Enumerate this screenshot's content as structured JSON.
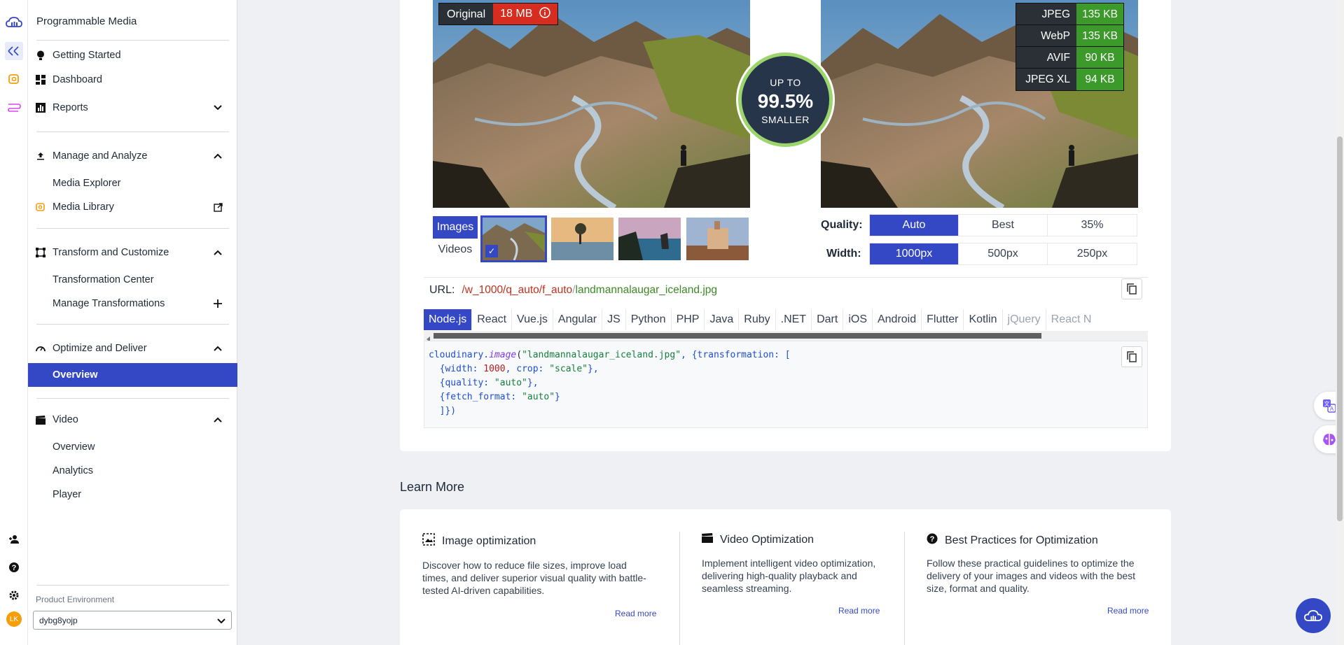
{
  "sidebar": {
    "title": "Programmable Media",
    "items": [
      {
        "label": "Getting Started"
      },
      {
        "label": "Dashboard"
      },
      {
        "label": "Reports"
      },
      {
        "label": "Manage and Analyze"
      },
      {
        "label": "Media Explorer"
      },
      {
        "label": "Media Library"
      },
      {
        "label": "Transform and Customize"
      },
      {
        "label": "Transformation Center"
      },
      {
        "label": "Manage Transformations"
      },
      {
        "label": "Optimize and Deliver"
      },
      {
        "label": "Overview"
      },
      {
        "label": "Video"
      },
      {
        "label": "Overview"
      },
      {
        "label": "Analytics"
      },
      {
        "label": "Player"
      }
    ],
    "env_label": "Product Environment",
    "env_value": "dybg8yojp",
    "avatar_initials": "LK"
  },
  "compare": {
    "original_label": "Original",
    "original_size": "18 MB",
    "formats": [
      {
        "name": "JPEG",
        "size": "135 KB"
      },
      {
        "name": "WebP",
        "size": "135 KB"
      },
      {
        "name": "AVIF",
        "size": "90 KB"
      },
      {
        "name": "JPEG XL",
        "size": "94 KB"
      }
    ],
    "circle_top": "UP TO",
    "circle_value": "99.5%",
    "circle_bottom": "SMALLER"
  },
  "media_toggle": {
    "images": "Images",
    "videos": "Videos"
  },
  "quality": {
    "label": "Quality:",
    "options": [
      "Auto",
      "Best",
      "35%"
    ],
    "selected": "Auto"
  },
  "width": {
    "label": "Width:",
    "options": [
      "1000px",
      "500px",
      "250px"
    ],
    "selected": "1000px"
  },
  "url": {
    "label": "URL:",
    "slash": "/",
    "transform": "w_1000/q_auto/f_auto",
    "slash2": "/",
    "file": "landmannalaugar_iceland.jpg"
  },
  "langs": [
    "Node.js",
    "React",
    "Vue.js",
    "Angular",
    "JS",
    "Python",
    "PHP",
    "Java",
    "Ruby",
    ".NET",
    "Dart",
    "iOS",
    "Android",
    "Flutter",
    "Kotlin",
    "jQuery",
    "React N"
  ],
  "code": {
    "l1a": "cloudinary.",
    "l1b": "image",
    "l1c": "(",
    "l1d": "\"landmannalaugar_iceland.jpg\"",
    "l1e": ", {transformation: [",
    "l2a": "  {width: ",
    "l2b": "1000",
    "l2c": ", crop: ",
    "l2d": "\"scale\"",
    "l2e": "},",
    "l3a": "  {quality: ",
    "l3b": "\"auto\"",
    "l3c": "},",
    "l4a": "  {fetch_format: ",
    "l4b": "\"auto\"",
    "l4c": "}",
    "l5": "  ]})"
  },
  "learn": {
    "title": "Learn More",
    "cards": [
      {
        "title": "Image optimization",
        "text": "Discover how to reduce file sizes, improve load times, and deliver superior visual quality with battle-tested AI-driven capabilities.",
        "link": "Read more"
      },
      {
        "title": "Video Optimization",
        "text": "Implement intelligent video optimization, delivering high-quality playback and seamless streaming.",
        "link": "Read more"
      },
      {
        "title": "Best Practices for Optimization",
        "text": "Follow these practical guidelines to optimize the delivery of your images and videos with the best size, format and quality.",
        "link": "Read more"
      }
    ]
  },
  "colors": {
    "accent": "#3448c5",
    "original_badge": "#d62d20",
    "format_badge": "#3c9a2b",
    "circle_ring": "#9bd56b"
  }
}
